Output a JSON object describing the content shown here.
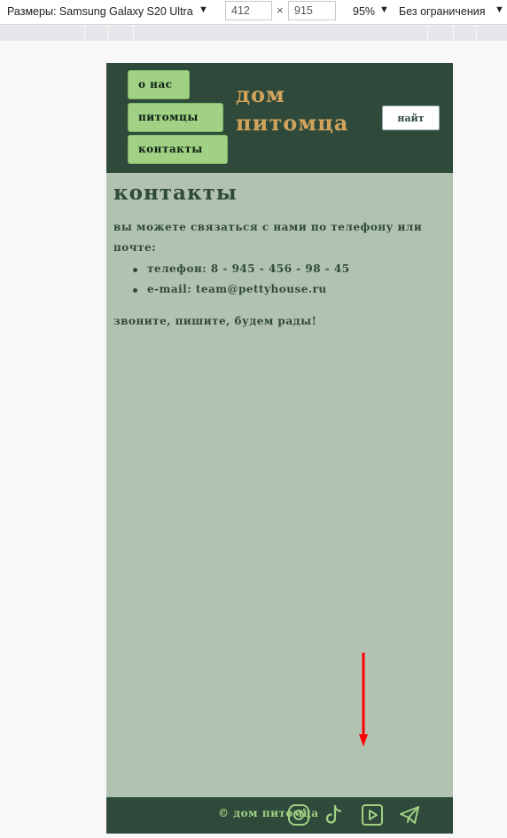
{
  "devtools": {
    "device_label": "Размеры: Samsung Galaxy S20 Ultra",
    "width_value": "412",
    "times_sign": "×",
    "height_value": "915",
    "zoom_value": "95%",
    "throttle_value": "Без ограничения",
    "dropdown_arrow": "▼"
  },
  "header": {
    "nav": {
      "about": "о нас",
      "pets": "питомцы",
      "contacts": "контакты"
    },
    "logo_line1": "дом",
    "logo_line2": "питомца",
    "search_label": "найт"
  },
  "main": {
    "heading": "контакты",
    "intro": "вы можете связаться с нами по телефону или почте:",
    "contacts": [
      {
        "text": "телефон: 8 - 945 - 456 - 98 - 45"
      },
      {
        "text": "e-mail: team@pettyhouse.ru"
      }
    ],
    "outro": "звоните, пишите, будем рады!"
  },
  "footer": {
    "copyright": "© дом питомца",
    "socials": [
      "instagram-icon",
      "tiktok-icon",
      "youtube-icon",
      "telegram-icon"
    ]
  },
  "colors": {
    "header_bg": "#2f4a3a",
    "page_bg": "#b2c2b0",
    "nav_button": "#a0d185",
    "logo": "#d1a45e",
    "annotation_arrow": "#ff0000"
  }
}
